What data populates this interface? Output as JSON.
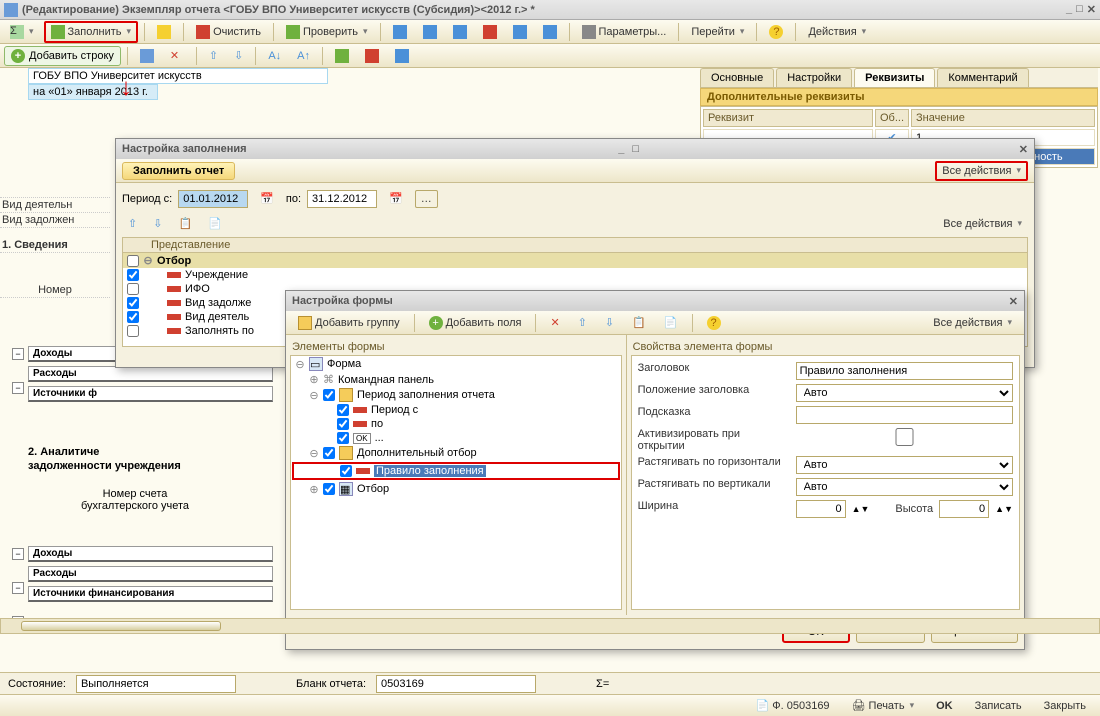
{
  "window": {
    "title": "(Редактирование) Экземпляр отчета <ГОБУ ВПО Университет искусств (Субсидия)><2012 г.> *"
  },
  "toolbar": {
    "fill": "Заполнить",
    "clear": "Очистить",
    "check": "Проверить",
    "params": "Параметры...",
    "go": "Перейти",
    "actions": "Действия"
  },
  "row2": {
    "add": "Добавить строку"
  },
  "report": {
    "org": "ГОБУ ВПО Университет искусств",
    "date": "на «01» января 2013 г.",
    "label_vid_deyat": "Вид деятельн",
    "label_vid_zadol": "Вид задолжен",
    "label_svedeniya": "1. Сведения",
    "label_nomer": "Номер",
    "sec_dohody": "Доходы",
    "sec_rashody": "Расходы",
    "sec_istoch": "Источники ф",
    "label_analit": "2. Аналитиче",
    "label_zadol2": "задолженности учреждения",
    "label_nomer2": "Номер счета",
    "label_buh": "бухгалтерского учета",
    "sec_istoch_full": "Источники финансирования"
  },
  "tabs": {
    "osnov": "Основные",
    "nastr": "Настройки",
    "rekv": "Реквизиты",
    "komm": "Комментарий"
  },
  "rekv": {
    "title": "Дополнительные реквизиты",
    "col_rekv": "Реквизит",
    "col_ob": "Об...",
    "col_znach": "Значение",
    "rows": [
      {
        "r": "",
        "ch": true,
        "v": "1"
      },
      {
        "r": "",
        "ch": true,
        "v": "Дебиторская задолженность"
      }
    ]
  },
  "dlg1": {
    "title": "Настройка заполнения",
    "fill_btn": "Заполнить отчет",
    "all_actions": "Все действия",
    "period_from": "Период с:",
    "date_from": "01.01.2012",
    "period_to": "по:",
    "date_to": "31.12.2012",
    "repr": "Представление",
    "otbor": "Отбор",
    "items": [
      "Учреждение",
      "ИФО",
      "Вид задолже",
      "Вид деятель",
      "Заполнять по"
    ]
  },
  "dlg2": {
    "title": "Настройка формы",
    "add_group": "Добавить группу",
    "add_field": "Добавить поля",
    "all_actions": "Все действия",
    "elem_hdr": "Элементы формы",
    "prop_hdr": "Свойства элемента формы",
    "tree": {
      "form": "Форма",
      "cmdpanel": "Командная панель",
      "period": "Период заполнения отчета",
      "period_s": "Период с",
      "period_po": "по",
      "ok": "...",
      "dop_otbor": "Дополнительный отбор",
      "pravilo": "Правило заполнения",
      "otbor": "Отбор"
    },
    "props": {
      "zagolovok": "Заголовок",
      "zagolovok_val": "Правило заполнения",
      "poloz": "Положение заголовка",
      "poloz_val": "Авто",
      "podskazka": "Подсказка",
      "podskazka_val": "",
      "aktiv": "Активизировать при открытии",
      "rast_h": "Растягивать по горизонтали",
      "rast_h_val": "Авто",
      "rast_v": "Растягивать по вертикали",
      "rast_v_val": "Авто",
      "shirina": "Ширина",
      "shirina_val": "0",
      "vysota": "Высота",
      "vysota_val": "0"
    },
    "ok": "OK",
    "cancel": "Отмена",
    "apply": "Применить"
  },
  "status": {
    "sost": "Состояние:",
    "sost_val": "Выполняется",
    "blank": "Бланк отчета:",
    "blank_val": "0503169",
    "sigma": "Σ=",
    "form": "Ф. 0503169",
    "print": "Печать",
    "ok": "OK",
    "zapisat": "Записать",
    "zakryt": "Закрыть"
  }
}
